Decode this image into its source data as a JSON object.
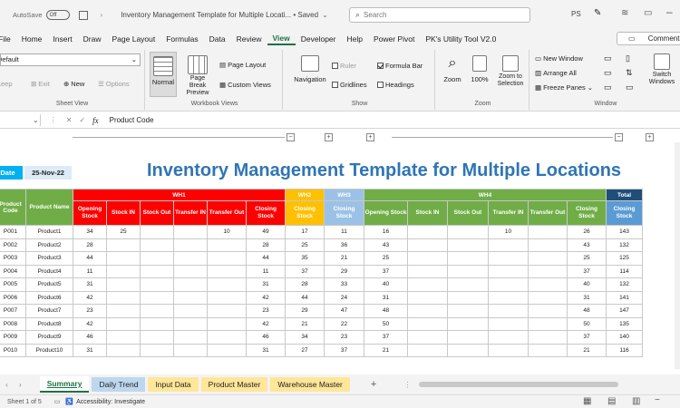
{
  "titlebar": {
    "autosave_label": "AutoSave",
    "autosave_state": "Off",
    "doc_title": "Inventory Management Template for Multiple Locati... • Saved",
    "search_placeholder": "Search",
    "user_initials": "PS"
  },
  "ribbon_tabs": [
    "File",
    "Home",
    "Insert",
    "Draw",
    "Page Layout",
    "Formulas",
    "Data",
    "Review",
    "View",
    "Developer",
    "Help",
    "Power Pivot",
    "PK's Utility Tool V2.0"
  ],
  "active_tab": "View",
  "comments_button": "Comments",
  "ribbon": {
    "sheet_view": {
      "label": "Sheet View",
      "dropdown_value": "Default",
      "keep": "Keep",
      "exit": "Exit",
      "new": "New",
      "options": "Options"
    },
    "workbook_views": {
      "label": "Workbook Views",
      "normal": "Normal",
      "page_break": "Page Break Preview",
      "page_layout": "Page Layout",
      "custom_views": "Custom Views"
    },
    "show": {
      "label": "Show",
      "navigation": "Navigation",
      "ruler": "Ruler",
      "formula_bar": "Formula Bar",
      "gridlines": "Gridlines",
      "headings": "Headings"
    },
    "zoom": {
      "label": "Zoom",
      "zoom": "Zoom",
      "hundred": "100%",
      "zoom_to_selection": "Zoom to Selection"
    },
    "window": {
      "label": "Window",
      "new_window": "New Window",
      "arrange_all": "Arrange All",
      "freeze_panes": "Freeze Panes",
      "switch_windows": "Switch Windows"
    }
  },
  "formula_bar": {
    "cell_ref": "",
    "content": "Product Code"
  },
  "sheet": {
    "title": "Inventory Management Template for Multiple Locations",
    "date_label": "Date",
    "date_value": "25-Nov-22",
    "headers": {
      "product_code": "Product Code",
      "product_name": "Product Name",
      "wh1": "WH1",
      "wh2": "WH2",
      "wh3": "WH3",
      "wh4": "WH4",
      "total": "Total",
      "opening_stock": "Opening Stock",
      "stock_in": "Stock IN",
      "stock_out": "Stock Out",
      "transfer_in": "Transfer IN",
      "transfer_out": "Transfer Out",
      "closing_stock": "Closing Stock"
    },
    "rows": [
      {
        "code": "P001",
        "name": "Product1",
        "wh1": [
          "34",
          "25",
          "",
          "",
          "10",
          "49"
        ],
        "wh2": "17",
        "wh3": "11",
        "wh4": [
          "16",
          "",
          "",
          "10",
          "",
          "26"
        ],
        "total": "143"
      },
      {
        "code": "P002",
        "name": "Product2",
        "wh1": [
          "28",
          "",
          "",
          "",
          "",
          "28"
        ],
        "wh2": "25",
        "wh3": "36",
        "wh4": [
          "43",
          "",
          "",
          "",
          "",
          "43"
        ],
        "total": "132"
      },
      {
        "code": "P003",
        "name": "Product3",
        "wh1": [
          "44",
          "",
          "",
          "",
          "",
          "44"
        ],
        "wh2": "35",
        "wh3": "21",
        "wh4": [
          "25",
          "",
          "",
          "",
          "",
          "25"
        ],
        "total": "125"
      },
      {
        "code": "P004",
        "name": "Product4",
        "wh1": [
          "11",
          "",
          "",
          "",
          "",
          "11"
        ],
        "wh2": "37",
        "wh3": "29",
        "wh4": [
          "37",
          "",
          "",
          "",
          "",
          "37"
        ],
        "total": "114"
      },
      {
        "code": "P005",
        "name": "Product5",
        "wh1": [
          "31",
          "",
          "",
          "",
          "",
          "31"
        ],
        "wh2": "28",
        "wh3": "33",
        "wh4": [
          "40",
          "",
          "",
          "",
          "",
          "40"
        ],
        "total": "132"
      },
      {
        "code": "P006",
        "name": "Product6",
        "wh1": [
          "42",
          "",
          "",
          "",
          "",
          "42"
        ],
        "wh2": "44",
        "wh3": "24",
        "wh4": [
          "31",
          "",
          "",
          "",
          "",
          "31"
        ],
        "total": "141"
      },
      {
        "code": "P007",
        "name": "Product7",
        "wh1": [
          "23",
          "",
          "",
          "",
          "",
          "23"
        ],
        "wh2": "29",
        "wh3": "47",
        "wh4": [
          "48",
          "",
          "",
          "",
          "",
          "48"
        ],
        "total": "147"
      },
      {
        "code": "P008",
        "name": "Product8",
        "wh1": [
          "42",
          "",
          "",
          "",
          "",
          "42"
        ],
        "wh2": "21",
        "wh3": "22",
        "wh4": [
          "50",
          "",
          "",
          "",
          "",
          "50"
        ],
        "total": "135"
      },
      {
        "code": "P009",
        "name": "Product9",
        "wh1": [
          "46",
          "",
          "",
          "",
          "",
          "46"
        ],
        "wh2": "34",
        "wh3": "23",
        "wh4": [
          "37",
          "",
          "",
          "",
          "",
          "37"
        ],
        "total": "140"
      },
      {
        "code": "P010",
        "name": "Product10",
        "wh1": [
          "31",
          "",
          "",
          "",
          "",
          "31"
        ],
        "wh2": "27",
        "wh3": "37",
        "wh4": [
          "21",
          "",
          "",
          "",
          "",
          "21"
        ],
        "total": "116"
      }
    ]
  },
  "sheet_tabs": [
    "Summary",
    "Daily Trend",
    "Input Data",
    "Product Master",
    "Warehouse Master"
  ],
  "active_sheet": "Summary",
  "status": {
    "sheet_info": "Sheet 1 of 5",
    "accessibility": "Accessibility: Investigate"
  },
  "colors": {
    "title_blue": "#2f75b5",
    "wh1_red": "#ff0000",
    "wh4_green": "#70ad47",
    "total_navy": "#1f4e79"
  }
}
